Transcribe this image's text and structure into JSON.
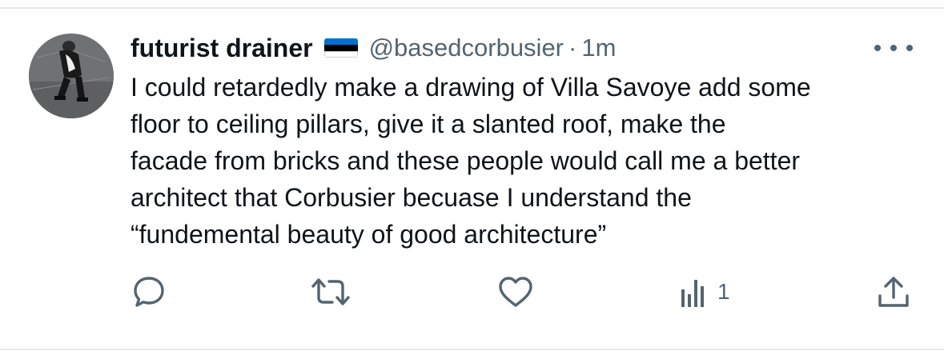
{
  "tweet": {
    "display_name": "futurist drainer",
    "flag_icon": "flag-estonia-icon",
    "handle": "@basedcorbusier",
    "separator": "·",
    "time": "1m",
    "text_lines": [
      "I could retardedly make a drawing of Villa Savoye add some",
      "floor to ceiling pillars, give it a slanted roof, make the",
      "facade from bricks and these people would call me a better",
      "architect that Corbusier becuase I understand the",
      "“fundemental beauty of good architecture”"
    ]
  },
  "actions": {
    "reply_icon": "reply-icon",
    "retweet_icon": "retweet-icon",
    "like_icon": "heart-icon",
    "views_icon": "views-chart-icon",
    "views_count": "1",
    "share_icon": "share-icon"
  },
  "colors": {
    "text": "#0f1419",
    "secondary": "#536471",
    "divider": "#e6e9ec",
    "flag_blue": "#0072ce",
    "flag_black": "#000000",
    "flag_white": "#ffffff"
  }
}
